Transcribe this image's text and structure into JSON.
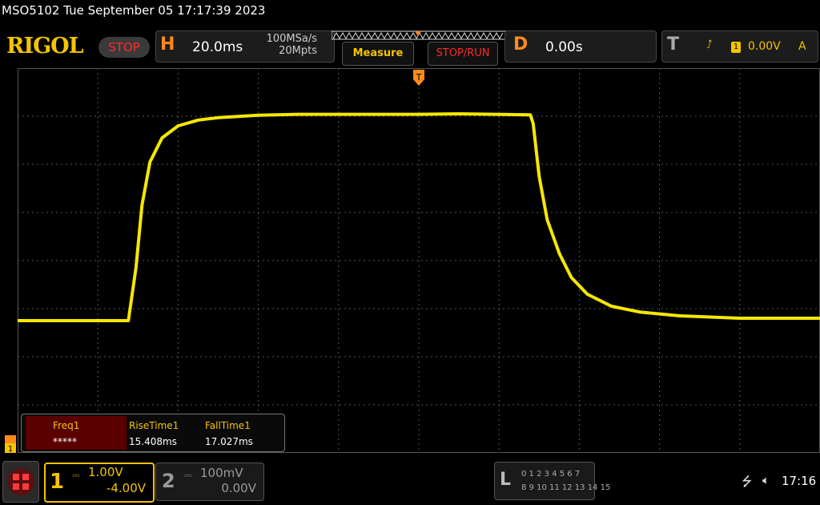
{
  "status_line": "MSO5102  Tue September 05 17:17:39 2023",
  "logo": "RIGOL",
  "run_state": "STOP",
  "horizontal": {
    "letter": "H",
    "timebase": "20.0ms",
    "sample_rate": "100MSa/s",
    "memory_depth": "20Mpts"
  },
  "buttons": {
    "measure": "Measure",
    "stop_run": "STOP/RUN"
  },
  "delay": {
    "letter": "D",
    "value": "0.00s"
  },
  "trigger": {
    "letter": "T",
    "channel": "1",
    "level": "0.00V",
    "mode": "A",
    "marker": "T"
  },
  "measurements": [
    {
      "label": "Freq1",
      "value": "*****"
    },
    {
      "label": "RiseTime1",
      "value": "15.408ms"
    },
    {
      "label": "FallTime1",
      "value": "17.027ms"
    }
  ],
  "channel1": {
    "number": "1",
    "scale": "1.00V",
    "offset": "-4.00V",
    "ground_marker": "1"
  },
  "channel2": {
    "number": "2",
    "scale": "100mV",
    "offset": "0.00V"
  },
  "logic_analyzer": {
    "letter": "L",
    "row1": "0 1 2 3  4 5 6 7",
    "row2": "8 9 10 11 12 13 14 15"
  },
  "status_icons": {
    "usb": "usb-icon",
    "speaker": "speaker-muted-icon"
  },
  "clock": "17:16",
  "colors": {
    "ch1": "#f5c400",
    "accent": "#ff8a1a",
    "stop": "#ff2a2a"
  },
  "waveform": {
    "unit": "V",
    "time_unit": "ms",
    "time_range": [
      -100,
      100
    ],
    "points": [
      [
        -100,
        -4.0
      ],
      [
        -72.4,
        -4.0
      ],
      [
        -70.5,
        -2.9
      ],
      [
        -69,
        -1.6
      ],
      [
        -67,
        -0.7
      ],
      [
        -64,
        -0.2
      ],
      [
        -60,
        0.05
      ],
      [
        -55,
        0.17
      ],
      [
        -50,
        0.22
      ],
      [
        -40,
        0.27
      ],
      [
        -30,
        0.29
      ],
      [
        0,
        0.29
      ],
      [
        10,
        0.3
      ],
      [
        27.8,
        0.28
      ],
      [
        28.5,
        0.1
      ],
      [
        30,
        -1.0
      ],
      [
        32,
        -1.9
      ],
      [
        35,
        -2.6
      ],
      [
        38,
        -3.1
      ],
      [
        42,
        -3.45
      ],
      [
        48,
        -3.7
      ],
      [
        55,
        -3.82
      ],
      [
        65,
        -3.9
      ],
      [
        80,
        -3.95
      ],
      [
        100,
        -3.95
      ]
    ]
  }
}
